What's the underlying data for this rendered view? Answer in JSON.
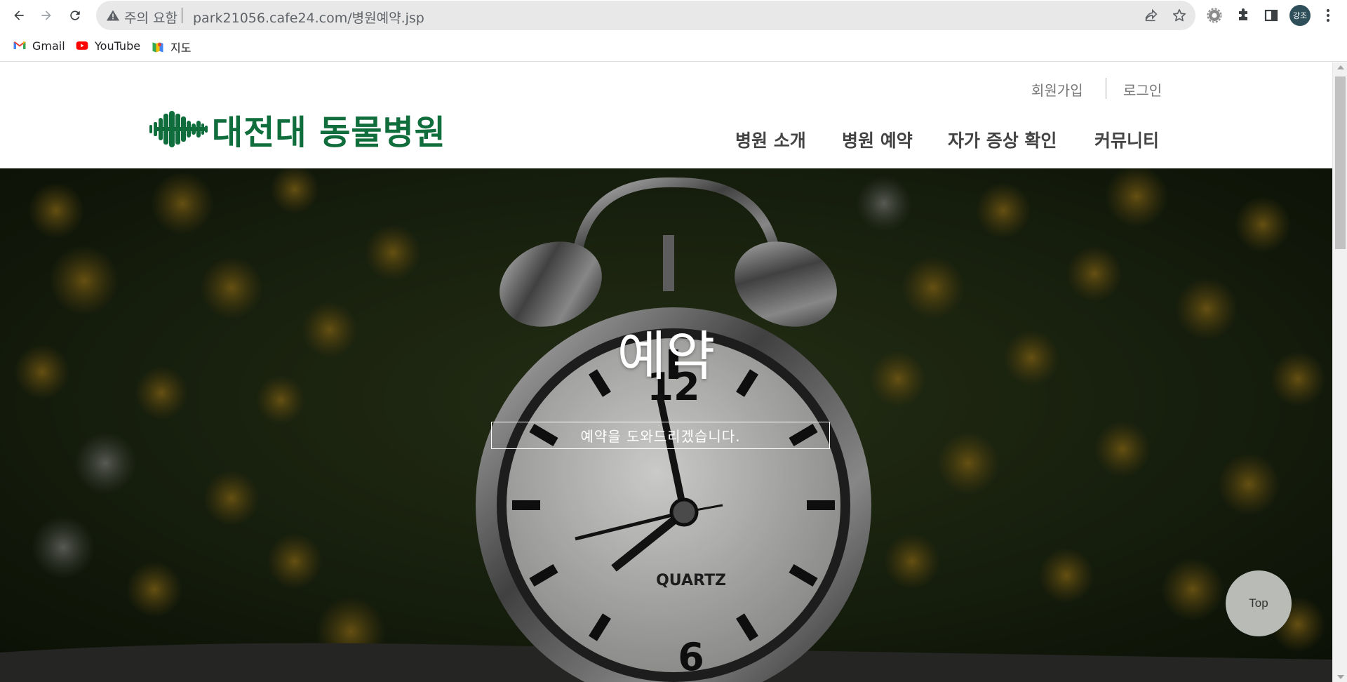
{
  "browser": {
    "security_label": "주의 요함",
    "url": "park21056.cafe24.com/병원예약.jsp",
    "profile_initials": "강조",
    "bookmarks": [
      {
        "label": "Gmail",
        "icon": "gmail-icon"
      },
      {
        "label": "YouTube",
        "icon": "youtube-icon"
      },
      {
        "label": "지도",
        "icon": "maps-icon"
      }
    ]
  },
  "site": {
    "logo_text": "대전대 동물병원",
    "brand_color": "#0f6e3c",
    "util_links": [
      "회원가입",
      "로그인"
    ],
    "nav": [
      "병원 소개",
      "병원 예약",
      "자가 증상 확인",
      "커뮤니티"
    ]
  },
  "hero": {
    "title": "예약",
    "subtitle": "예약을 도와드리겠습니다.",
    "clock_brand": "QUARTZ",
    "clock_numbers": [
      "12",
      "6"
    ]
  },
  "top_button": "Top"
}
